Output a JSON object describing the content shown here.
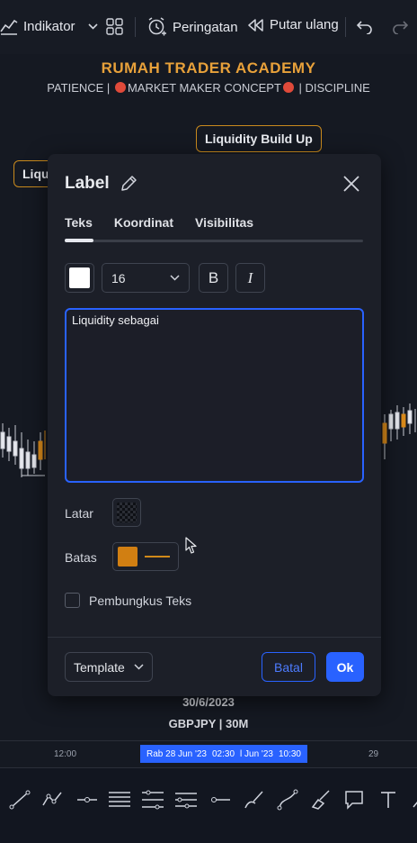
{
  "toolbar": {
    "indicator_label": "Indikator",
    "alert_label": "Peringatan",
    "replay_label": "Putar ulang"
  },
  "chart": {
    "brand_title": "RUMAH TRADER ACADEMY",
    "subtitle_left": "PATIENCE  |",
    "subtitle_mid": "MARKET MAKER CONCEPT",
    "subtitle_right": "|  DISCIPLINE",
    "label_top": "Liquidity Build Up",
    "label_left": "Liqu",
    "date_text": "30/6/2023",
    "symbol_text": "GBPJPY | 30M",
    "colors": {
      "accent": "#e8a13a",
      "label_border": "#c98a1d",
      "dot": "#e04a3a"
    }
  },
  "time_axis": {
    "label_left": "12:00",
    "highlight_a": "Rab 28 Jun '23",
    "highlight_b": "02:30",
    "highlight_c": "l Jun '23",
    "highlight_d": "10:30",
    "label_right": "29"
  },
  "dialog": {
    "title": "Label",
    "tabs": [
      "Teks",
      "Koordinat",
      "Visibilitas"
    ],
    "active_tab": "Teks",
    "text_color": "#ffffff",
    "font_size": "16",
    "bold_label": "B",
    "italic_label": "I",
    "text_value": "Liquidity sebagai",
    "background_label": "Latar",
    "border_label": "Batas",
    "border_color": "#d17f12",
    "wrap_label": "Pembungkus Teks",
    "wrap_checked": false,
    "template_label": "Template",
    "cancel_label": "Batal",
    "ok_label": "Ok"
  },
  "drawing_tools": [
    "trend-line-icon",
    "path-icon",
    "ray-icon",
    "parallel-channel-icon",
    "fib-retracement-icon",
    "fib-extension-icon",
    "horizontal-ray-icon",
    "brush-icon",
    "curve-icon",
    "highlighter-icon",
    "callout-icon",
    "text-icon"
  ]
}
